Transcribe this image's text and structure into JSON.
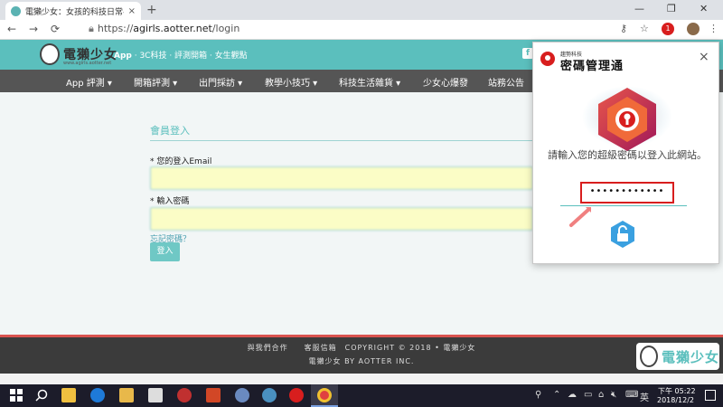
{
  "browser": {
    "tab_title": "電獺少女：女孩的科技日常-APP...",
    "tab_close": "×",
    "new_tab": "+",
    "url_scheme": "https://",
    "url_host": "agirls.aotter.net",
    "url_path": "/login",
    "win_minimize": "—",
    "win_restore": "❐",
    "win_close": "✕",
    "ext_badge": "1"
  },
  "site": {
    "logo_text": "電獺少女",
    "logo_sub": "www.agirls.aotter.net",
    "topnav_main": "App",
    "topnav_rest": " · 3C科技 · 評測開箱 · 女生觀點",
    "fb": "f",
    "menu": [
      "App 評測 ▾",
      "開箱評測 ▾",
      "出門採訪 ▾",
      "教學小技巧 ▾",
      "科技生活雜貨 ▾",
      "少女心爆發",
      "站務公告"
    ]
  },
  "login": {
    "title": "會員登入",
    "email_label": "* 您的登入Email",
    "email_value": "",
    "password_label": "* 輸入密碼",
    "password_value": "",
    "forgot": "忘記密碼？",
    "submit": "登入"
  },
  "footer": {
    "row1": "與我們合作　　客服信箱　COPYRIGHT © 2018 • 電獺少女",
    "row2": "電獺少女 BY AOTTER INC.",
    "logo_text": "電獺少女"
  },
  "taskbar": {
    "time": "下午 05:22",
    "date": "2018/12/2"
  },
  "password_manager": {
    "brand": "趨勢科技",
    "name": "密碼管理通",
    "close": "×",
    "message": "請輸入您的超級密碼以登入此網站。",
    "password_mask": "••••••••••••",
    "accent_color": "#d81e1e",
    "unlock_color": "#3aa0e0"
  }
}
